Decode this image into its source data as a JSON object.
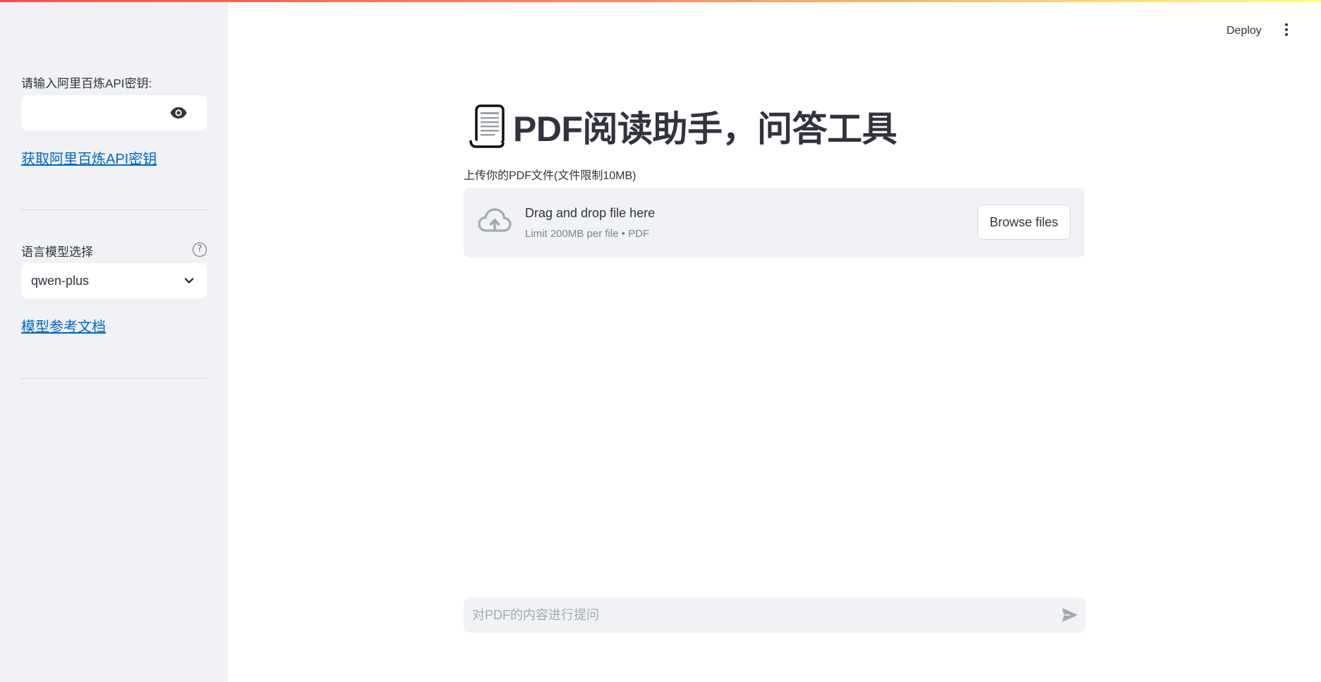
{
  "app": {
    "deploy_label": "Deploy"
  },
  "sidebar": {
    "api_key_label": "请输入阿里百炼API密钥:",
    "api_key_value": "",
    "get_key_link": "获取阿里百炼API密钥",
    "model_label": "语言模型选择",
    "model_help": "?",
    "model_selected": "qwen-plus",
    "model_docs_link": "模型参考文档"
  },
  "main": {
    "title": "PDF阅读助手，问答工具",
    "upload_label": "上传你的PDF文件(文件限制10MB)",
    "dropzone_title": "Drag and drop file here",
    "dropzone_sub": "Limit 200MB per file • PDF",
    "browse_label": "Browse files",
    "chat_placeholder": "对PDF的内容进行提问"
  },
  "icons": [
    "eye-icon",
    "help-icon",
    "chevron-down-icon",
    "scroll-icon",
    "cloud-upload-icon",
    "send-icon",
    "more-vertical-icon"
  ],
  "colors": {
    "accent_link": "#0068c9",
    "sidebar_bg": "#f0f2f6",
    "text": "#31333f",
    "top_gradient_start": "#ff4b4b",
    "top_gradient_end": "#fffd80"
  }
}
